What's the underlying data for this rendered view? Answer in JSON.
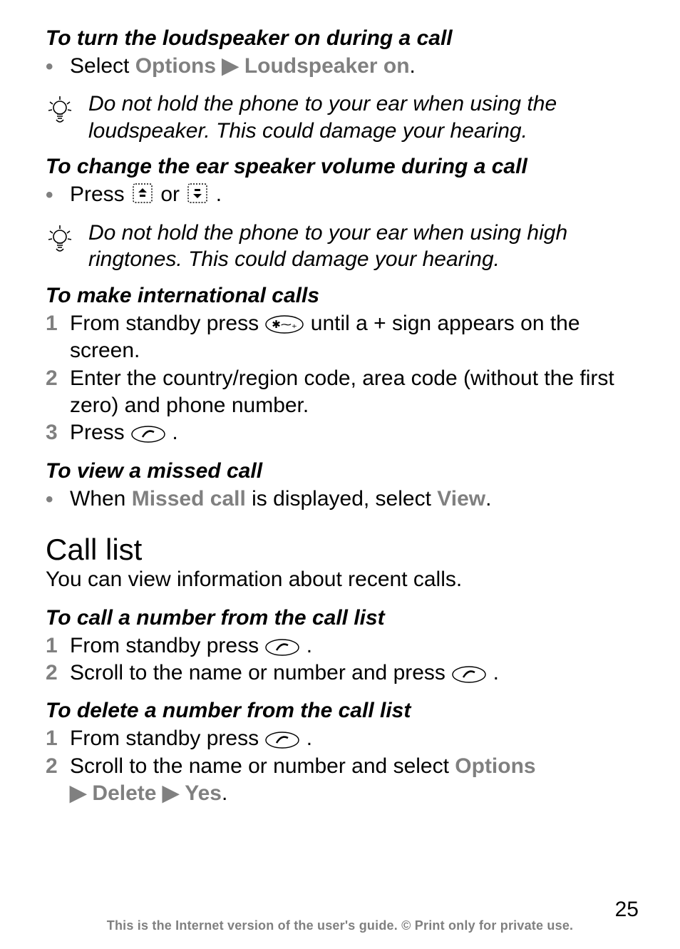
{
  "s1": {
    "title": "To turn the loudspeaker on during a call",
    "b1_a": "Select ",
    "b1_opt": "Options",
    "b1_mid": " ",
    "b1_ls": "Loudspeaker on",
    "b1_end": "."
  },
  "tip1": "Do not hold the phone to your ear when using the loudspeaker. This could damage your hearing.",
  "s2": {
    "title": "To change the ear speaker volume during a call",
    "b1_a": "Press ",
    "b1_mid": " or ",
    "b1_end": " ."
  },
  "tip2": "Do not hold the phone to your ear when using high ringtones. This could damage your hearing.",
  "s3": {
    "title": "To make international calls",
    "n1_a": "From standby press ",
    "n1_b": " until a + sign appears on the screen.",
    "n2": "Enter the country/region code, area code (without the first zero) and phone number.",
    "n3_a": "Press ",
    "n3_b": "."
  },
  "s4": {
    "title": "To view a missed call",
    "b1_a": "When ",
    "b1_mc": "Missed call",
    "b1_mid": " is displayed, select ",
    "b1_view": "View",
    "b1_end": "."
  },
  "h2": "Call list",
  "h2_sub": "You can view information about recent calls.",
  "s5": {
    "title": "To call a number from the call list",
    "n1_a": "From standby press ",
    "n1_b": ".",
    "n2_a": "Scroll to the name or number and press ",
    "n2_b": "."
  },
  "s6": {
    "title": "To delete a number from the call list",
    "n1_a": "From standby press ",
    "n1_b": ".",
    "n2_a": "Scroll to the name or number and select ",
    "n2_opt": "Options",
    "n2_line2_del": "Delete",
    "n2_line2_yes": "Yes",
    "n2_line2_end": "."
  },
  "markers": {
    "bullet": "•",
    "arrow": "▶",
    "one": "1",
    "two": "2",
    "three": "3"
  },
  "footer": {
    "page": "25",
    "line": "This is the Internet version of the user's guide. © Print only for private use."
  },
  "icons": {
    "tip": "lightbulb-tip-icon",
    "vol_up": "volume-up-key-icon",
    "vol_down": "volume-down-key-icon",
    "star_key": "star-key-icon",
    "call_key": "call-key-icon"
  }
}
